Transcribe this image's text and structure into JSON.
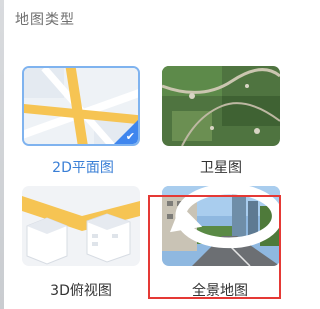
{
  "panel": {
    "title": "地图类型"
  },
  "map_types": [
    {
      "label": "2D平面图",
      "selected": true
    },
    {
      "label": "卫星图",
      "selected": false
    },
    {
      "label": "3D俯视图",
      "selected": false
    },
    {
      "label": "全景地图",
      "selected": false
    }
  ],
  "colors": {
    "accent": "#3f86ee",
    "highlight_box": "#e53935",
    "selected_text": "#3a7fd6",
    "normal_text": "#333333"
  }
}
